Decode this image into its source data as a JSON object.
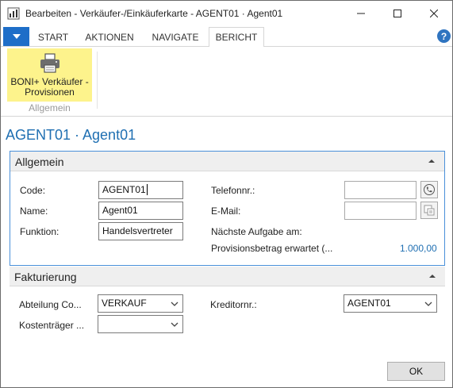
{
  "window": {
    "title": "Bearbeiten - Verkäufer-/Einkäuferkarte - AGENT01 · Agent01"
  },
  "ribbon_tabs": [
    {
      "label": "START"
    },
    {
      "label": "AKTIONEN"
    },
    {
      "label": "NAVIGATE"
    },
    {
      "label": "BERICHT"
    }
  ],
  "active_tab": "BERICHT",
  "ribbon": {
    "button_label": "BONI+ Verkäufer - Provisionen",
    "group_label": "Allgemein"
  },
  "page_title": "AGENT01 · Agent01",
  "general": {
    "header": "Allgemein",
    "code_label": "Code:",
    "code_value": "AGENT01",
    "name_label": "Name:",
    "name_value": "Agent01",
    "function_label": "Funktion:",
    "function_value": "Handelsvertreter",
    "phone_label": "Telefonnr.:",
    "phone_value": "",
    "email_label": "E-Mail:",
    "email_value": "",
    "next_task_label": "Nächste Aufgabe am:",
    "commission_label": "Provisionsbetrag erwartet (...",
    "commission_value": "1.000,00"
  },
  "invoicing": {
    "header": "Fakturierung",
    "dept_label": "Abteilung Co...",
    "dept_value": "VERKAUF",
    "cost_label": "Kostenträger ...",
    "cost_value": "",
    "creditor_label": "Kreditornr.:",
    "creditor_value": "AGENT01"
  },
  "ok_label": "OK"
}
